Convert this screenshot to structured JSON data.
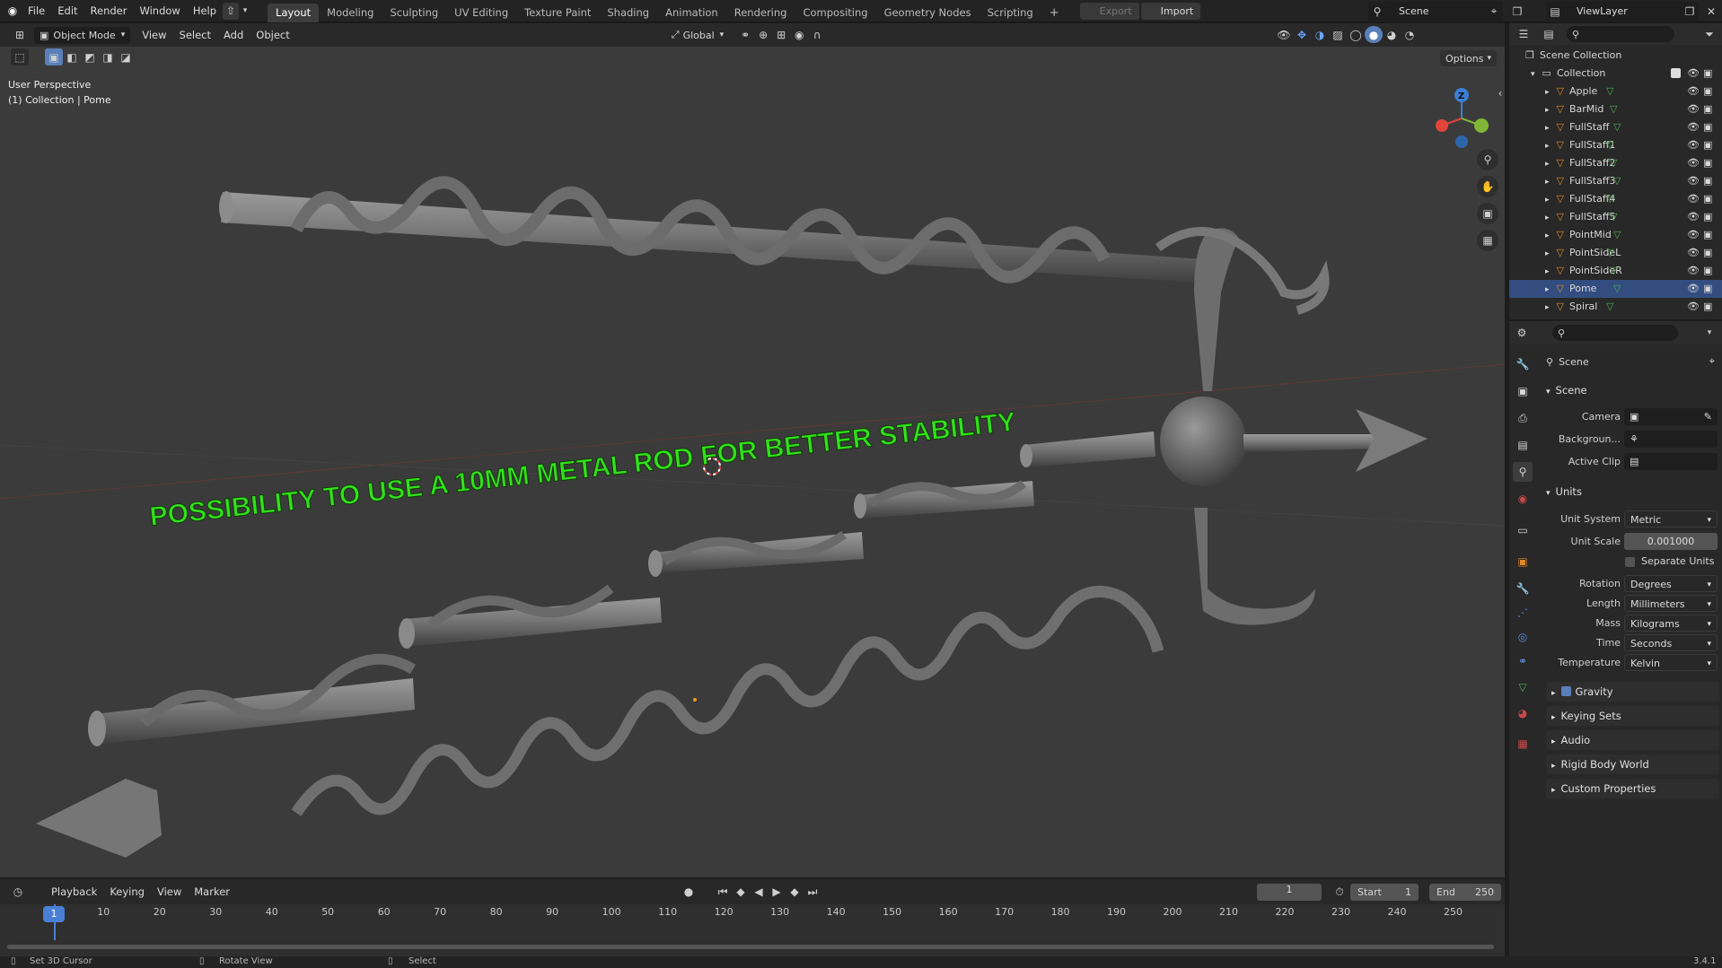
{
  "menus": [
    "File",
    "Edit",
    "Render",
    "Window",
    "Help"
  ],
  "workspaces": [
    "Layout",
    "Modeling",
    "Sculpting",
    "UV Editing",
    "Texture Paint",
    "Shading",
    "Animation",
    "Rendering",
    "Compositing",
    "Geometry Nodes",
    "Scripting"
  ],
  "active_workspace": "Layout",
  "topbar_buttons": {
    "export": "Export",
    "import": "Import",
    "scene": "Scene",
    "viewlayer": "ViewLayer"
  },
  "viewport_header": {
    "mode": "Object Mode",
    "menus": [
      "View",
      "Select",
      "Add",
      "Object"
    ],
    "orientation": "Global",
    "options": "Options"
  },
  "viewport": {
    "perspective": "User Perspective",
    "context": "(1) Collection | Pome",
    "overlay_text": "POSSIBILITY TO USE A 10MM METAL ROD FOR BETTER STABILITY",
    "overlay_color": "#33e01c",
    "gizmo": {
      "x_color": "#e2453a",
      "y_color": "#7fb636",
      "z_color": "#3b7fd6",
      "z_label": "Z"
    }
  },
  "outliner": {
    "root": "Scene Collection",
    "collection": "Collection",
    "items": [
      "Apple",
      "BarMid",
      "FullStaff",
      "FullStaff1",
      "FullStaff2",
      "FullStaff3",
      "FullStaff4",
      "FullStaff5",
      "PointMid",
      "PointSideL",
      "PointSideR",
      "Pome",
      "Spiral"
    ],
    "selected": "Pome"
  },
  "properties": {
    "header": "Scene",
    "scene_section": "Scene",
    "camera_label": "Camera",
    "background_label": "Backgroun...",
    "active_clip_label": "Active Clip",
    "units_section": "Units",
    "unit_system_label": "Unit System",
    "unit_system": "Metric",
    "unit_scale_label": "Unit Scale",
    "unit_scale": "0.001000",
    "separate_units": "Separate Units",
    "rotation_label": "Rotation",
    "rotation": "Degrees",
    "length_label": "Length",
    "length": "Millimeters",
    "mass_label": "Mass",
    "mass": "Kilograms",
    "time_label": "Time",
    "time": "Seconds",
    "temperature_label": "Temperature",
    "temperature": "Kelvin",
    "collapsed_sections": [
      "Gravity",
      "Keying Sets",
      "Audio",
      "Rigid Body World",
      "Custom Properties"
    ]
  },
  "timeline": {
    "menus": [
      "Playback",
      "Keying",
      "View",
      "Marker"
    ],
    "current_frame": "1",
    "start_label": "Start",
    "start": "1",
    "end_label": "End",
    "end": "250",
    "ticks": [
      "1",
      "10",
      "20",
      "30",
      "40",
      "50",
      "60",
      "70",
      "80",
      "90",
      "100",
      "110",
      "120",
      "130",
      "140",
      "150",
      "160",
      "170",
      "180",
      "190",
      "200",
      "210",
      "220",
      "230",
      "240",
      "250"
    ]
  },
  "statusbar": {
    "left": "Set 3D Cursor",
    "middle": "Rotate View",
    "right": "Select",
    "version": "3.4.1"
  }
}
